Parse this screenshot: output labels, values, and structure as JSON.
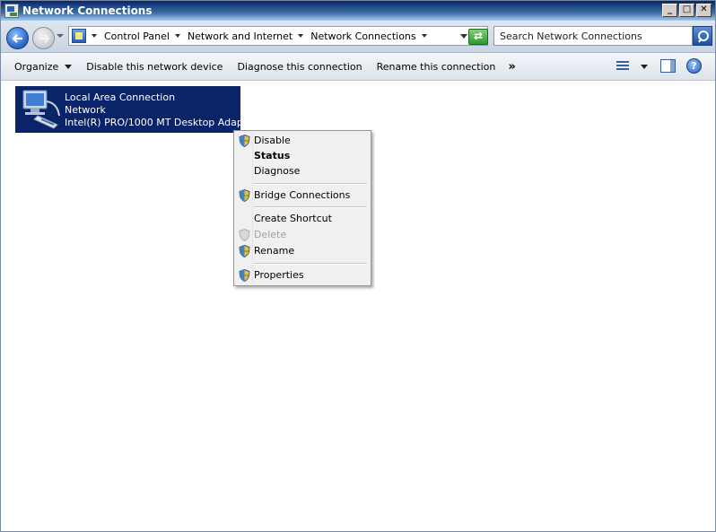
{
  "window": {
    "title": "Network Connections",
    "buttons": {
      "minimize": "_",
      "maximize": "□",
      "close": "✕"
    }
  },
  "address_bar": {
    "breadcrumbs": [
      "Control Panel",
      "Network and Internet",
      "Network Connections"
    ],
    "search_placeholder": "Search Network Connections",
    "refresh_glyph": "⇄"
  },
  "command_bar": {
    "organize": "Organize",
    "items": [
      "Disable this network device",
      "Diagnose this connection",
      "Rename this connection"
    ],
    "more": "»",
    "help": "?"
  },
  "connection": {
    "name": "Local Area Connection",
    "network": "Network",
    "adapter": "Intel(R) PRO/1000 MT Desktop Adap..."
  },
  "context_menu": {
    "disable": "Disable",
    "status": "Status",
    "diagnose": "Diagnose",
    "bridge": "Bridge Connections",
    "create_shortcut": "Create Shortcut",
    "delete": "Delete",
    "rename": "Rename",
    "properties": "Properties"
  },
  "colors": {
    "selection": "#0a246a",
    "titlebar": "#0a246a",
    "menu_bg": "#f0f0f0"
  }
}
